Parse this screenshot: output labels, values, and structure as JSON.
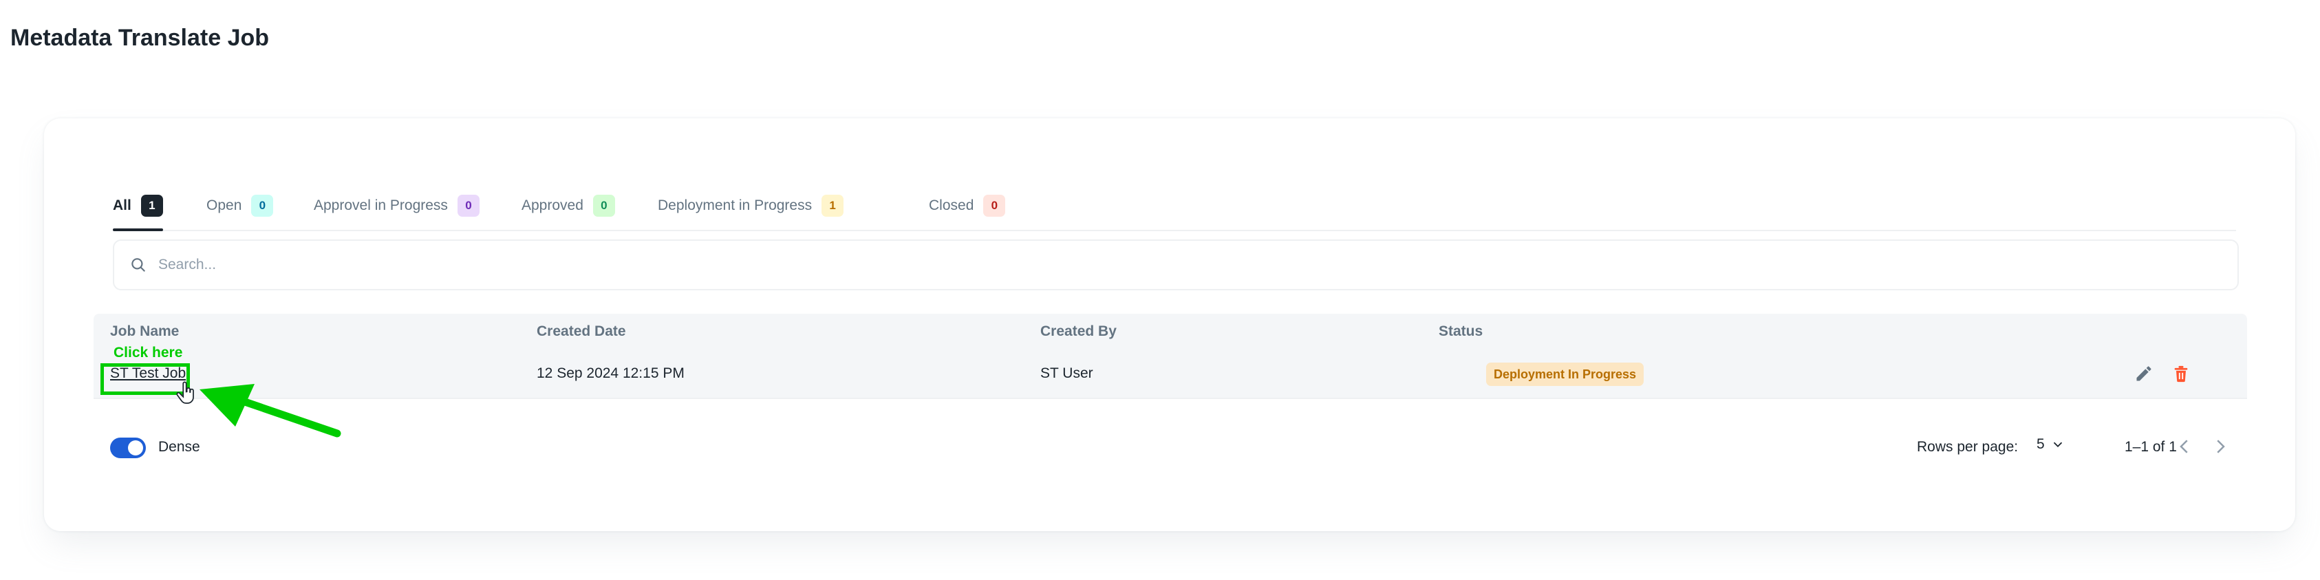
{
  "page": {
    "title": "Metadata Translate Job"
  },
  "tabs": [
    {
      "label": "All",
      "count": "1",
      "badge_bg": "#1c252e",
      "badge_fg": "#ffffff"
    },
    {
      "label": "Open",
      "count": "0",
      "badge_bg": "#cafdf5",
      "badge_fg": "#006c9c"
    },
    {
      "label": "Approvel in Progress",
      "count": "0",
      "badge_bg": "#ead9fb",
      "badge_fg": "#6e2bb7"
    },
    {
      "label": "Approved",
      "count": "0",
      "badge_bg": "#d3fcd2",
      "badge_fg": "#118d57"
    },
    {
      "label": "Deployment in Progress",
      "count": "1",
      "badge_bg": "#fff5cc",
      "badge_fg": "#b76e00"
    },
    {
      "label": "Closed",
      "count": "0",
      "badge_bg": "#ffe4de",
      "badge_fg": "#b71d18"
    }
  ],
  "search": {
    "placeholder": "Search...",
    "icon": "search-icon"
  },
  "table": {
    "columns": [
      "Job Name",
      "Created Date",
      "Created By",
      "Status"
    ],
    "rows": [
      {
        "job_name": "ST Test Job",
        "created_date": "12 Sep 2024 12:15 PM",
        "created_by": "ST User",
        "status": "Deployment In Progress",
        "actions": [
          "edit-icon",
          "delete-icon"
        ]
      }
    ]
  },
  "footer": {
    "dense_label": "Dense",
    "dense_enabled": true,
    "rows_per_page_label": "Rows per page:",
    "rows_per_page_value": "5",
    "range": "1–1 of 1"
  },
  "annotation": {
    "text": "Click here",
    "color": "#00cc00"
  },
  "colors": {
    "accent": "#1e5ed6",
    "delete": "#ff5630",
    "status_bg": "#fce6c3",
    "status_fg": "#b76e00"
  }
}
